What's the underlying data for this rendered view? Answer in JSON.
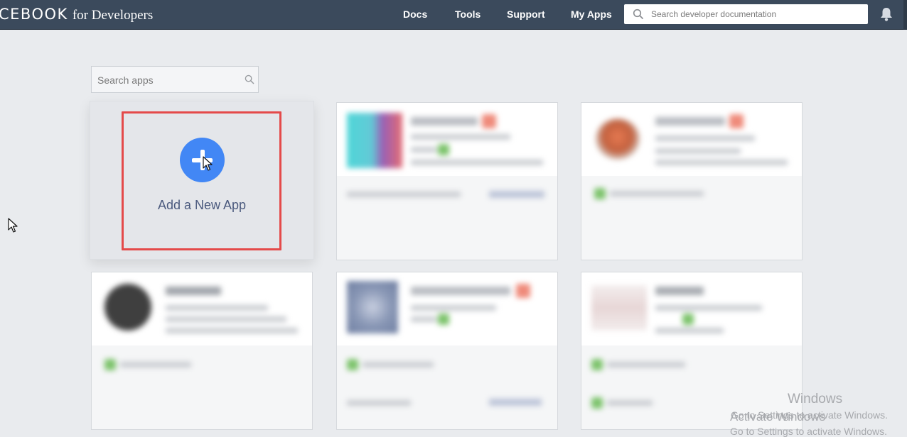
{
  "topbar": {
    "brand_main": "CEBOOK",
    "brand_sub": "for Developers",
    "nav": [
      "Docs",
      "Tools",
      "Support",
      "My Apps"
    ],
    "search_placeholder": "Search developer documentation",
    "bell_icon": "bell-icon",
    "search_icon": "search-icon"
  },
  "apps": {
    "search_placeholder": "Search apps",
    "search_icon": "search-icon",
    "add_label": "Add a New App",
    "add_icon": "plus-icon",
    "highlight_color": "#e44a4a",
    "accent_color": "#4287f5"
  },
  "watermark": {
    "line1": "Windows",
    "line2": "Go to Settings to activate Windows.",
    "line3": "Activate Windows",
    "line4": "Go to Settings to activate Windows."
  }
}
